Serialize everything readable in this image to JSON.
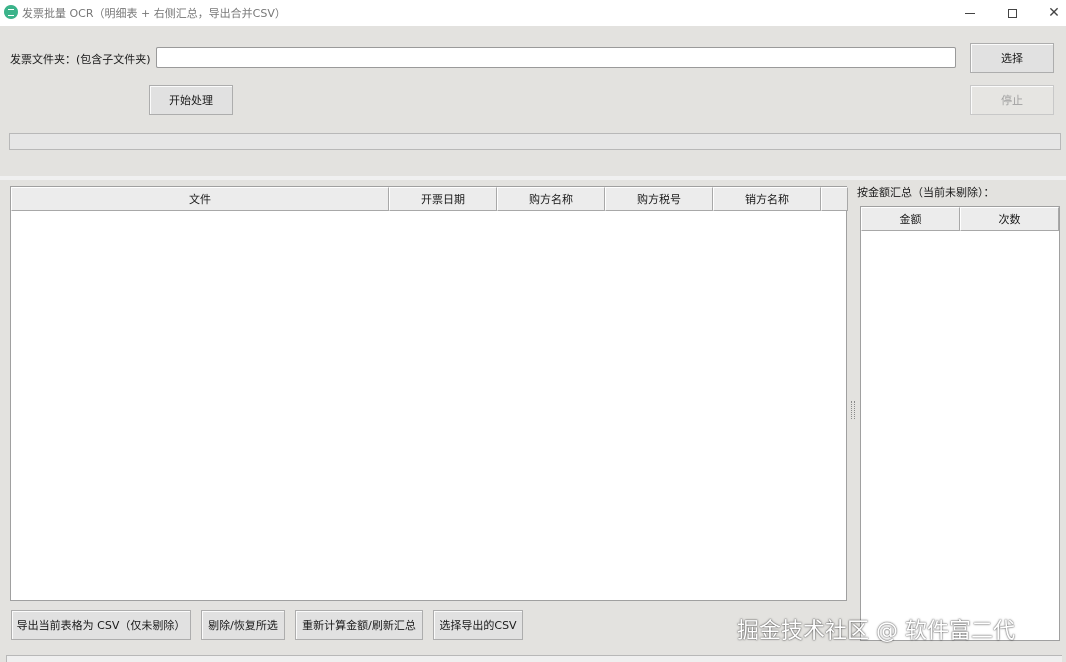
{
  "window": {
    "title": "发票批量 OCR（明细表 + 右侧汇总，导出合并CSV）",
    "close_glyph": "✕"
  },
  "folder": {
    "label": "发票文件夹：(包含子文件夹)",
    "value": "",
    "choose_label": "选择"
  },
  "controls": {
    "start_label": "开始处理",
    "stop_label": "停止"
  },
  "progress": {
    "value": 0
  },
  "main_table": {
    "columns": [
      "文件",
      "开票日期",
      "购方名称",
      "购方税号",
      "销方名称"
    ],
    "rows": []
  },
  "summary": {
    "label": "按金额汇总（当前未剔除）：",
    "columns": [
      "金额",
      "次数"
    ],
    "rows": []
  },
  "actions": {
    "export_label": "导出当前表格为 CSV（仅未剔除）",
    "toggle_label": "剔除/恢复所选",
    "recalc_label": "重新计算金额/刷新汇总",
    "select_export_label": "选择导出的CSV"
  },
  "watermark": "掘金技术社区 @ 软件富二代"
}
